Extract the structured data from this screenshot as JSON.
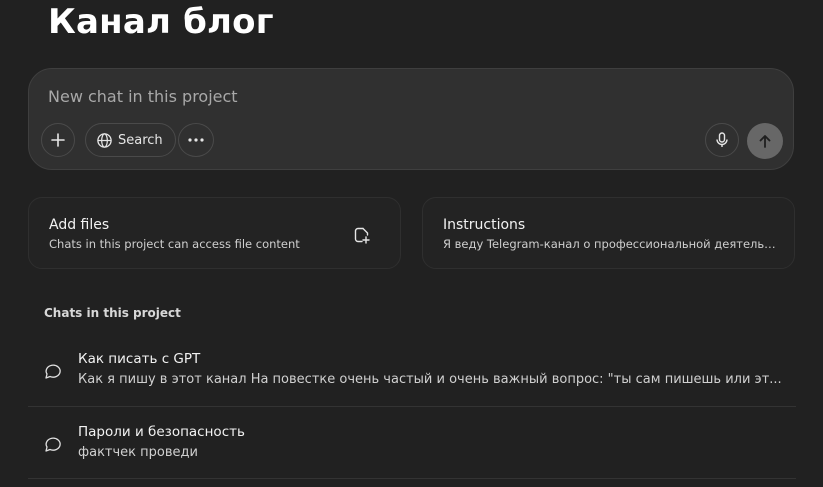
{
  "project": {
    "title": "Канал блог"
  },
  "composer": {
    "placeholder": "New chat in this project",
    "search_label": "Search",
    "icons": {
      "add": "plus-icon",
      "search": "globe-icon",
      "more": "more-icon",
      "mic": "mic-icon",
      "send": "arrow-up-icon"
    }
  },
  "cards": {
    "files": {
      "title": "Add files",
      "subtitle": "Chats in this project can access file content",
      "icon": "add-file-icon"
    },
    "instructions": {
      "title": "Instructions",
      "subtitle": "Я веду Telegram-канал о профессиональной деятельн..."
    }
  },
  "chats": {
    "section_label": "Chats in this project",
    "items": [
      {
        "title": "Как писать с GPT",
        "snippet": "Как я пишу в этот канал На повестке очень частый и очень важный вопрос: \"ты сам пишешь или эт...",
        "icon": "chat-bubble-icon"
      },
      {
        "title": "Пароли и безопасность",
        "snippet": "фактчек проведи",
        "icon": "chat-bubble-icon"
      }
    ]
  },
  "colors": {
    "background": "#212121",
    "composer": "#303030",
    "send_button": "#676767"
  }
}
